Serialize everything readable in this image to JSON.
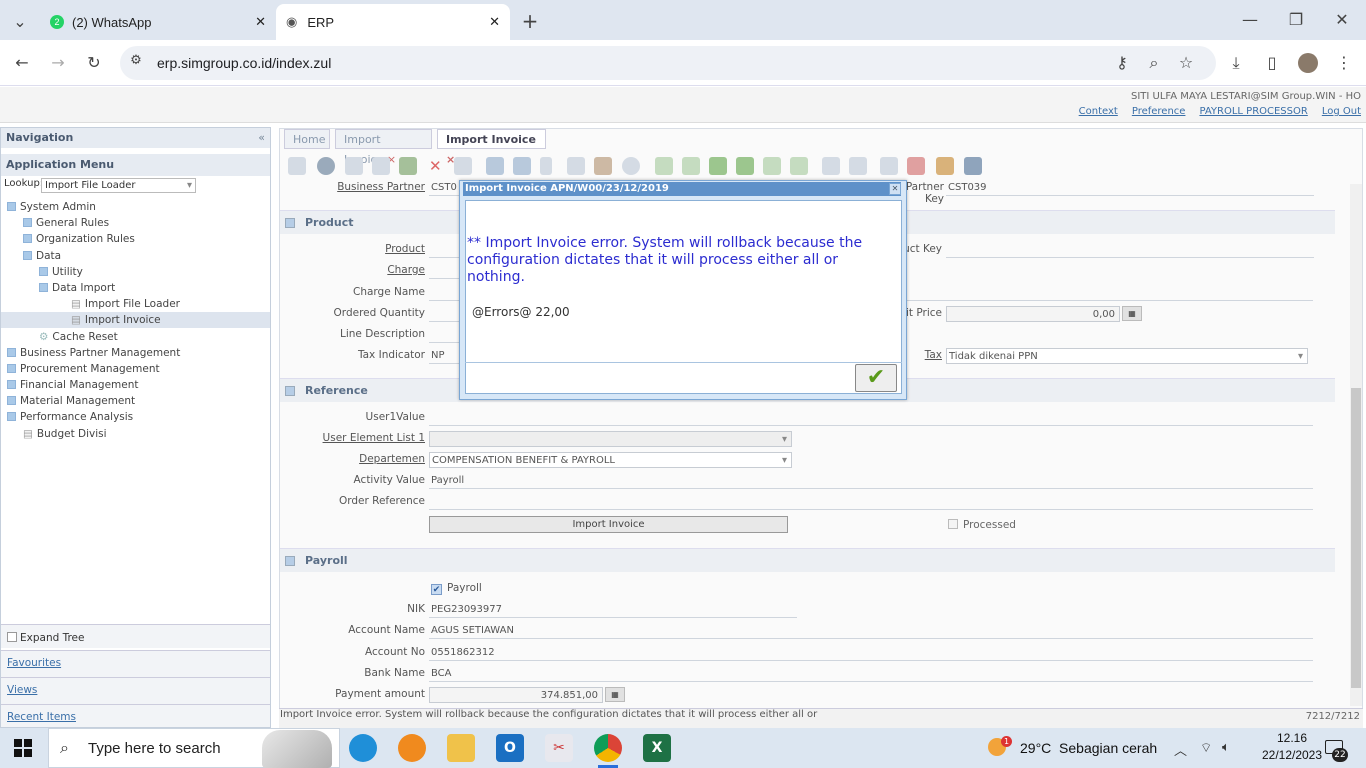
{
  "browser": {
    "tabs": [
      {
        "title": "(2) WhatsApp",
        "badge": "2"
      },
      {
        "title": "ERP"
      }
    ],
    "url": "erp.simgroup.co.id/index.zul",
    "new_tab": "+"
  },
  "header": {
    "user": "SITI ULFA MAYA LESTARI@SIM Group.WIN - HO",
    "links": [
      "Context",
      "Preference",
      "PAYROLL PROCESSOR",
      "Log Out"
    ]
  },
  "nav": {
    "title": "Navigation",
    "app_menu": "Application Menu",
    "lookup_label": "Lookup:",
    "lookup_value": "Import File Loader",
    "tree": [
      {
        "label": "System Admin",
        "level": 0
      },
      {
        "label": "General Rules",
        "level": 1
      },
      {
        "label": "Organization Rules",
        "level": 1
      },
      {
        "label": "Data",
        "level": 1
      },
      {
        "label": "Utility",
        "level": 2
      },
      {
        "label": "Data Import",
        "level": 2
      },
      {
        "label": "Import File Loader",
        "level": 3
      },
      {
        "label": "Import Invoice",
        "level": 3
      },
      {
        "label": "Cache Reset",
        "level": 2
      },
      {
        "label": "Business Partner Management",
        "level": 0
      },
      {
        "label": "Procurement Management",
        "level": 0
      },
      {
        "label": "Financial Management",
        "level": 0
      },
      {
        "label": "Material Management",
        "level": 0
      },
      {
        "label": "Performance Analysis",
        "level": 0
      },
      {
        "label": "Budget Divisi",
        "level": 1
      }
    ],
    "expand_tree": "Expand Tree",
    "favourites": "Favourites",
    "views": "Views",
    "recent": "Recent Items"
  },
  "tabs": [
    "Home",
    "Import Invoice",
    "Import Invoice"
  ],
  "form": {
    "bp_label": "Business Partner",
    "bp_value": "CST0",
    "bpkey_label": "Business Partner Key",
    "bpkey_value": "CST039",
    "product_section": "Product",
    "product": "Product",
    "charge": "Charge",
    "charge_name": "Charge Name",
    "ordered_qty": "Ordered Quantity",
    "line_desc": "Line Description",
    "tax_indicator": "Tax Indicator",
    "tax_indicator_value": "NP",
    "product_key": "Product Key",
    "unit_price": "Unit Price",
    "unit_price_value": "0,00",
    "tax": "Tax",
    "tax_value": "Tidak dikenai PPN",
    "reference_section": "Reference",
    "user1": "User1Value",
    "uel1": "User Element List 1",
    "dept": "Departemen",
    "dept_value": "COMPENSATION BENEFIT & PAYROLL",
    "activity": "Activity Value",
    "activity_value": "Payroll",
    "order_ref": "Order Reference",
    "import_btn": "Import Invoice",
    "processed": "Processed",
    "payroll_section": "Payroll",
    "payroll_chk": "Payroll",
    "nik": "NIK",
    "nik_value": "PEG23093977",
    "acct_name": "Account Name",
    "acct_name_value": "AGUS SETIAWAN",
    "acct_no": "Account No",
    "acct_no_value": "0551862312",
    "bank": "Bank Name",
    "bank_value": "BCA",
    "payment": "Payment amount",
    "payment_value": "374.851,00"
  },
  "status": {
    "message": "Import Invoice error. System will rollback because the configuration dictates that it will process either all or",
    "record": "7212/7212"
  },
  "dialog": {
    "title": "Import Invoice APN/W00/23/12/2019",
    "message": "** Import Invoice error. System will rollback because the configuration dictates that it will process either all or nothing.",
    "errors": "@Errors@  22,00"
  },
  "taskbar": {
    "search_placeholder": "Type here to search",
    "weather": "29°C  Sebagian cerah",
    "weather_badge": "1",
    "time": "12.16",
    "date": "22/12/2023",
    "notif": "22"
  },
  "colors": {
    "accent": "#5e91c9",
    "error_text": "#2c2cd0"
  }
}
